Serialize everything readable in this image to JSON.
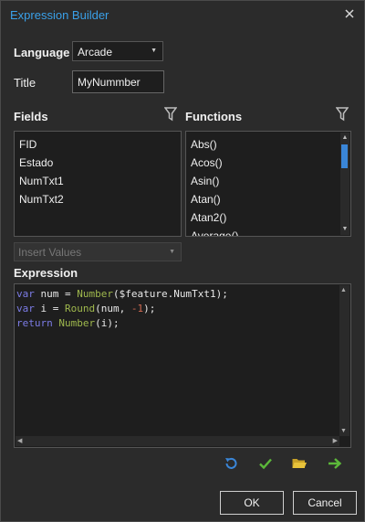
{
  "window": {
    "title": "Expression Builder"
  },
  "language": {
    "label": "Language",
    "value": "Arcade"
  },
  "title_field": {
    "label": "Title",
    "value": "MyNummber"
  },
  "fields": {
    "label": "Fields",
    "items": [
      "FID",
      "Estado",
      "NumTxt1",
      "NumTxt2"
    ]
  },
  "functions": {
    "label": "Functions",
    "items": [
      "Abs()",
      "Acos()",
      "Asin()",
      "Atan()",
      "Atan2()",
      "Average()"
    ]
  },
  "insert_values": {
    "placeholder": "Insert Values"
  },
  "expression": {
    "label": "Expression",
    "lines": [
      [
        {
          "t": "var",
          "c": "kw"
        },
        {
          "t": " num = "
        },
        {
          "t": "Number",
          "c": "fn"
        },
        {
          "t": "($feature.NumTxt1);"
        }
      ],
      [
        {
          "t": "var",
          "c": "kw"
        },
        {
          "t": " i = "
        },
        {
          "t": "Round",
          "c": "fn"
        },
        {
          "t": "(num, "
        },
        {
          "t": "-1",
          "c": "num"
        },
        {
          "t": ");"
        }
      ],
      [
        {
          "t": "return",
          "c": "kw"
        },
        {
          "t": " "
        },
        {
          "t": "Number",
          "c": "fn"
        },
        {
          "t": "(i);"
        }
      ]
    ]
  },
  "toolbar": {
    "icons": [
      "undo-icon",
      "check-icon",
      "folder-open-icon",
      "arrow-right-icon"
    ]
  },
  "buttons": {
    "ok": "OK",
    "cancel": "Cancel"
  },
  "colors": {
    "accent": "#3aa0e8",
    "keyword": "#7c7ce6",
    "function": "#9fb84d",
    "number": "#d06a52",
    "ok_green": "#5cb83a",
    "folder": "#e8c33a"
  }
}
